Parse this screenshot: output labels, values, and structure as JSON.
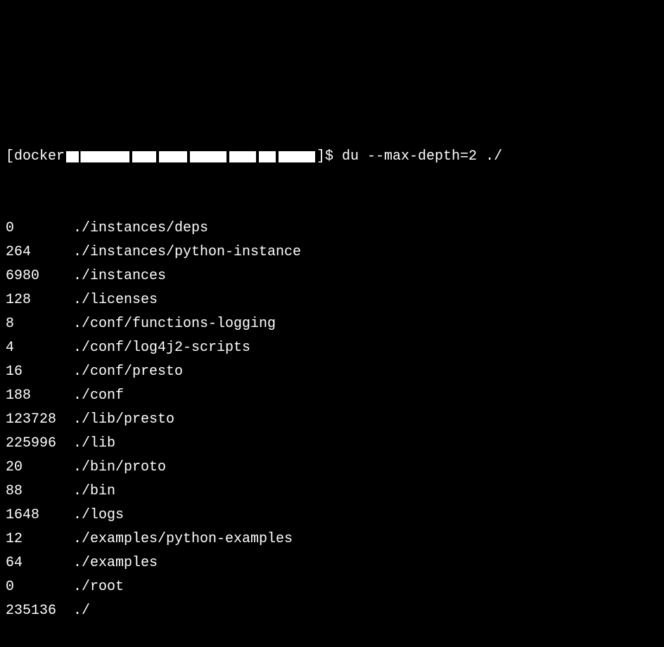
{
  "prompt": {
    "user_open": "[docker",
    "user_close": "]$ ",
    "command": "du --max-depth=2 ./"
  },
  "entries": [
    {
      "size": "0",
      "path": "./instances/deps"
    },
    {
      "size": "264",
      "path": "./instances/python-instance"
    },
    {
      "size": "6980",
      "path": "./instances"
    },
    {
      "size": "128",
      "path": "./licenses"
    },
    {
      "size": "8",
      "path": "./conf/functions-logging"
    },
    {
      "size": "4",
      "path": "./conf/log4j2-scripts"
    },
    {
      "size": "16",
      "path": "./conf/presto"
    },
    {
      "size": "188",
      "path": "./conf"
    },
    {
      "size": "123728",
      "path": "./lib/presto"
    },
    {
      "size": "225996",
      "path": "./lib"
    },
    {
      "size": "20",
      "path": "./bin/proto"
    },
    {
      "size": "88",
      "path": "./bin"
    },
    {
      "size": "1648",
      "path": "./logs"
    },
    {
      "size": "12",
      "path": "./examples/python-examples"
    },
    {
      "size": "64",
      "path": "./examples"
    },
    {
      "size": "0",
      "path": "./root"
    },
    {
      "size": "235136",
      "path": "./"
    }
  ]
}
